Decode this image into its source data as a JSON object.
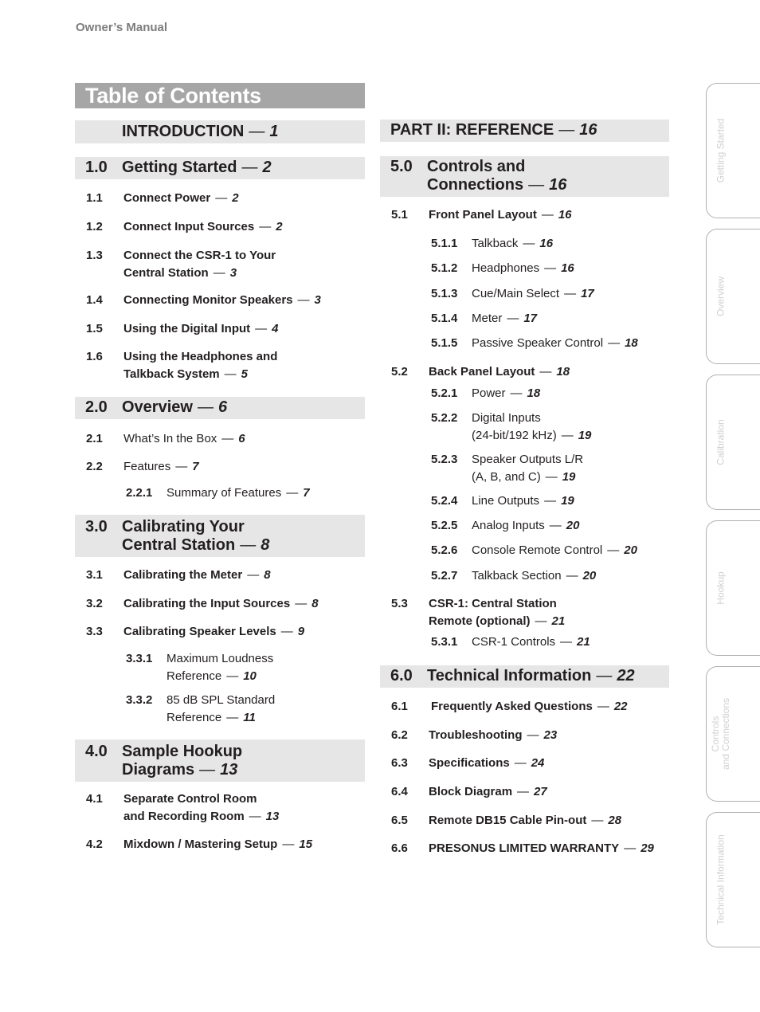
{
  "running_head": "Owner’s Manual",
  "title": "Table of Contents",
  "dash": "—",
  "left": {
    "intro": {
      "text": "INTRODUCTION",
      "page": "1"
    },
    "s1": {
      "num": "1.0",
      "text": "Getting Started",
      "page": "2"
    },
    "s1_items": [
      {
        "num": "1.1",
        "line1": "Connect Power",
        "page": "2"
      },
      {
        "num": "1.2",
        "line1": "Connect Input Sources",
        "page": "2"
      },
      {
        "num": "1.3",
        "line1": "Connect the CSR-1 to Your",
        "line2": "Central Station",
        "page": "3"
      },
      {
        "num": "1.4",
        "line1": "Connecting Monitor Speakers",
        "page": "3"
      },
      {
        "num": "1.5",
        "line1": "Using the Digital Input",
        "page": "4"
      },
      {
        "num": "1.6",
        "line1": "Using the Headphones and",
        "line2": "Talkback System",
        "page": "5"
      }
    ],
    "s2": {
      "num": "2.0",
      "text": "Overview",
      "page": "6"
    },
    "s2_items": [
      {
        "num": "2.1",
        "line1": "What’s In the Box",
        "page": "6"
      },
      {
        "num": "2.2",
        "line1": "Features",
        "page": "7"
      },
      {
        "num": "2.2.1",
        "line1": "Summary of Features",
        "page": "7"
      }
    ],
    "s3": {
      "num": "3.0",
      "line1": "Calibrating Your",
      "line2": "Central Station",
      "page": "8"
    },
    "s3_items": [
      {
        "num": "3.1",
        "line1": "Calibrating the Meter",
        "page": "8"
      },
      {
        "num": "3.2",
        "line1": "Calibrating the Input Sources",
        "page": "8"
      },
      {
        "num": "3.3",
        "line1": "Calibrating Speaker Levels",
        "page": "9"
      },
      {
        "num": "3.3.1",
        "line1": "Maximum Loudness",
        "line2": "Reference",
        "page": "10"
      },
      {
        "num": "3.3.2",
        "line1": "85 dB SPL Standard",
        "line2": "Reference",
        "page": "11"
      }
    ],
    "s4": {
      "num": "4.0",
      "line1": "Sample Hookup",
      "line2": "Diagrams",
      "page": "13"
    },
    "s4_items": [
      {
        "num": "4.1",
        "line1": "Separate Control Room",
        "line2": "and Recording Room",
        "page": "13"
      },
      {
        "num": "4.2",
        "line1": "Mixdown / Mastering Setup",
        "page": "15"
      }
    ]
  },
  "right": {
    "part2": {
      "text": "PART II: REFERENCE",
      "page": "16"
    },
    "s5": {
      "num": "5.0",
      "line1": "Controls and",
      "line2": "Connections",
      "page": "16"
    },
    "s5_items": [
      {
        "num": "5.1",
        "line1": "Front Panel Layout",
        "page": "16"
      },
      {
        "num": "5.1.1",
        "line1": "Talkback",
        "page": "16"
      },
      {
        "num": "5.1.2",
        "line1": "Headphones",
        "page": "16"
      },
      {
        "num": "5.1.3",
        "line1": "Cue/Main Select",
        "page": "17"
      },
      {
        "num": "5.1.4",
        "line1": "Meter",
        "page": "17"
      },
      {
        "num": "5.1.5",
        "line1": "Passive Speaker Control",
        "page": "18"
      },
      {
        "num": "5.2",
        "line1": "Back Panel Layout",
        "page": "18"
      },
      {
        "num": "5.2.1",
        "line1": "Power",
        "page": "18"
      },
      {
        "num": "5.2.2",
        "line1": "Digital Inputs",
        "line2": "(24-bit/192 kHz)",
        "page": "19"
      },
      {
        "num": "5.2.3",
        "line1": "Speaker Outputs L/R",
        "line2": "(A, B, and C)",
        "page": "19"
      },
      {
        "num": "5.2.4",
        "line1": "Line Outputs",
        "page": "19"
      },
      {
        "num": "5.2.5",
        "line1": "Analog Inputs",
        "page": "20"
      },
      {
        "num": "5.2.6",
        "line1": "Console Remote Control",
        "page": "20"
      },
      {
        "num": "5.2.7",
        "line1": "Talkback Section",
        "page": "20"
      },
      {
        "num": "5.3",
        "line1": "CSR-1: Central Station",
        "line2": "Remote (optional)",
        "page": "21"
      },
      {
        "num": "5.3.1",
        "line1": "CSR-1 Controls",
        "page": "21"
      }
    ],
    "s6": {
      "num": "6.0",
      "text": "Technical Information",
      "page": "22"
    },
    "s6_items": [
      {
        "num": "6.1",
        "line1": "Frequently Asked Questions",
        "page": "22"
      },
      {
        "num": "6.2",
        "line1": "Troubleshooting",
        "page": "23"
      },
      {
        "num": "6.3",
        "line1": "Specifications",
        "page": "24"
      },
      {
        "num": "6.4",
        "line1": "Block Diagram",
        "page": "27"
      },
      {
        "num": "6.5",
        "line1": "Remote DB15 Cable Pin-out",
        "page": "28"
      },
      {
        "num": "6.6",
        "line1": "PRESONUS LIMITED WARRANTY",
        "page": "29"
      }
    ]
  },
  "side_tabs": [
    {
      "label": "Getting Started"
    },
    {
      "label": "Overview"
    },
    {
      "label": "Calibration"
    },
    {
      "label": "Hookup"
    },
    {
      "label": "Controls",
      "label2": "and Connections"
    },
    {
      "label": "Technical Information"
    }
  ],
  "colors": {
    "title_bar": "#a6a6a6",
    "section_bar": "#e6e6e6",
    "tab_text": "#d0d0d0",
    "running_head": "#7d7d7d"
  }
}
